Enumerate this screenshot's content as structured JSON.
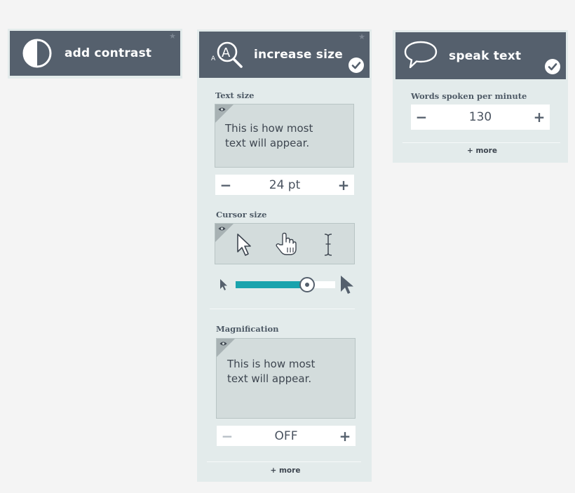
{
  "panels": {
    "contrast": {
      "title": "add contrast",
      "icon": "contrast-icon"
    },
    "size": {
      "title": "increase size",
      "icon": "magnify-text-icon",
      "text_size": {
        "label": "Text size",
        "preview": [
          "This is how most",
          "text will appear."
        ],
        "value": "24 pt",
        "minus": "−",
        "plus": "+"
      },
      "cursor_size": {
        "label": "Cursor size",
        "icons": [
          "arrow-cursor-icon",
          "hand-cursor-icon",
          "text-cursor-icon"
        ],
        "slider_level": 0.72
      },
      "magnification": {
        "label": "Magnification",
        "preview": [
          "This is how most",
          "text will appear."
        ],
        "value": "OFF",
        "minus": "−",
        "plus": "+"
      },
      "more": "+ more"
    },
    "speak": {
      "title": "speak text",
      "icon": "speech-bubble-icon",
      "wpm": {
        "label": "Words spoken per minute",
        "value": "130",
        "minus": "−",
        "plus": "+"
      },
      "more": "+ more"
    }
  },
  "colors": {
    "header": "#55606d",
    "panel_bg": "#e3ebeb",
    "accent": "#1aa3ad"
  }
}
